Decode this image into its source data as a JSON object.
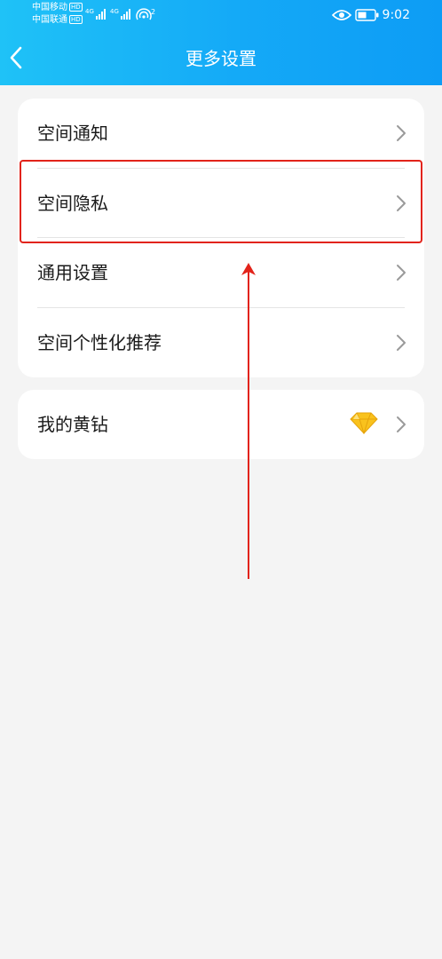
{
  "status_bar": {
    "carrier1": "中国移动",
    "carrier2": "中国联通",
    "hd_badge": "HD",
    "network1": "4G",
    "network2": "4G",
    "hotspot_count": "2",
    "time": "9:02"
  },
  "header": {
    "title": "更多设置"
  },
  "settings": {
    "items": [
      {
        "label": "空间通知"
      },
      {
        "label": "空间隐私"
      },
      {
        "label": "通用设置"
      },
      {
        "label": "空间个性化推荐"
      }
    ],
    "vip": {
      "label": "我的黄钻"
    }
  },
  "colors": {
    "header_gradient_start": "#1fc2f7",
    "header_gradient_end": "#0d9cf5",
    "highlight_red": "#e2231a",
    "diamond_yellow": "#f9c21d"
  }
}
